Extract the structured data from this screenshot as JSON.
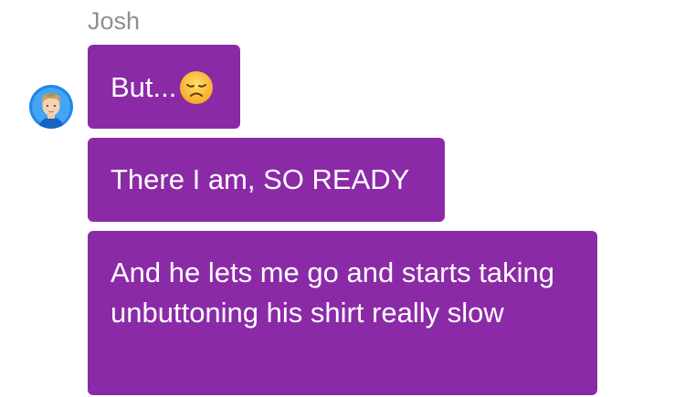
{
  "message_group": {
    "sender_name": "Josh",
    "avatar_icon": "user-avatar-icon",
    "bubble_color": "#8b2aa7",
    "messages": [
      {
        "text": "But...",
        "emoji": "disappointed-face-emoji"
      },
      {
        "text": "There I am, SO READY"
      },
      {
        "text": "And he lets me go and starts taking unbuttoning his shirt really slow"
      }
    ]
  }
}
